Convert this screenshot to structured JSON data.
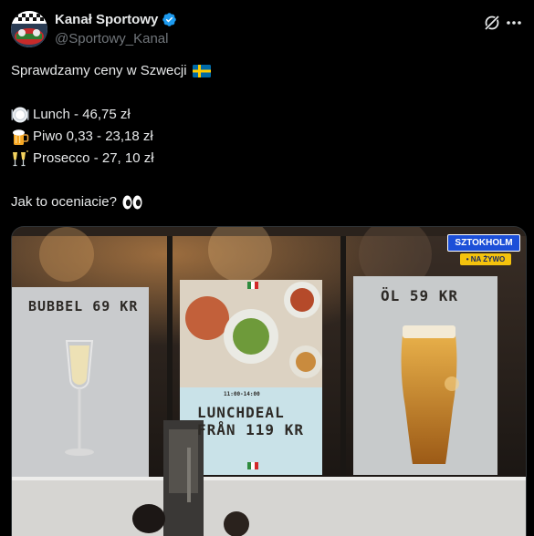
{
  "author": {
    "display_name": "Kanał Sportowy",
    "handle": "@Sportowy_Kanal",
    "avatar_icon": "kanal-sportowy-logo",
    "verified_color": "#1d9bf0"
  },
  "actions": {
    "grok_icon": "grok-icon",
    "more_icon": "more-icon"
  },
  "tweet": {
    "line1": "Sprawdzamy ceny w Szwecji",
    "flag_icon": "sweden-flag-icon",
    "items": [
      {
        "icon": "plate-icon",
        "text": "Lunch - 46,75 zł"
      },
      {
        "icon": "beer-icon",
        "text": "Piwo 0,33 - 23,18 zł"
      },
      {
        "icon": "champagne-icon",
        "text": "Prosecco - 27, 10 zł"
      }
    ],
    "question": "Jak to oceniacie?",
    "eyes_icon": "eyes-icon"
  },
  "media": {
    "poster_left": {
      "title": "BUBBEL 69 KR"
    },
    "poster_center": {
      "time": "11:00-14:00",
      "title_line1": "LUNCHDEAL",
      "title_line2": "FRÅN 119 KR"
    },
    "poster_right": {
      "title": "ÖL 59 KR"
    },
    "live_badge": {
      "city": "SZTOKHOLM",
      "status": "• NA ŻYWO"
    }
  }
}
